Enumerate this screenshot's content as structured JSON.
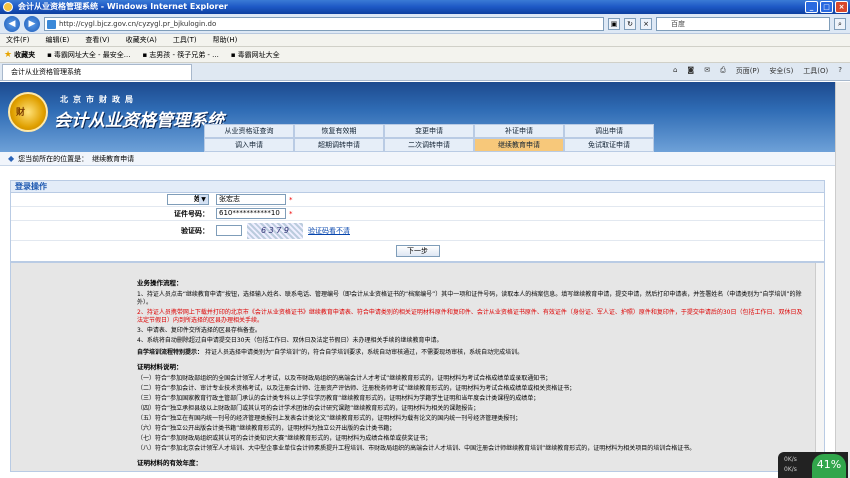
{
  "window": {
    "title": "会计从业资格管理系统 - Windows Internet Explorer",
    "url": "http://cygl.bjcz.gov.cn/cyzygl.pr_bjkulogin.do",
    "search_placeholder": "百度"
  },
  "menu": [
    "文件(F)",
    "编辑(E)",
    "查看(V)",
    "收藏夹(A)",
    "工具(T)",
    "帮助(H)"
  ],
  "favorites": [
    {
      "label": "收藏夹"
    },
    {
      "label": "毒霸网址大全 - 最安全..."
    },
    {
      "label": "志男孩 - 筷子兄弟 - ..."
    },
    {
      "label": "毒霸网址大全"
    }
  ],
  "tab": {
    "label": "会计从业资格管理系统"
  },
  "tools": [
    "页面(P)",
    "安全(S)",
    "工具(O)"
  ],
  "banner": {
    "subtitle": "北京市财政局",
    "brand": "会计从业资格管理系统",
    "logo_text": "财"
  },
  "nav": {
    "row1": [
      "从业资格证查询",
      "恢复有效期",
      "变更申请",
      "补证申请",
      "调出申请"
    ],
    "row2": [
      "调入申请",
      "超期调转申请",
      "二次调转申请",
      "继续教育申请",
      "免试取证申请"
    ],
    "active": "继续教育申请"
  },
  "location": {
    "label": "您当前所在的位置是：",
    "value": "继续教育申请"
  },
  "login": {
    "header": "登录操作",
    "name_select": "姓名",
    "name_value": "张宏志",
    "cert_label": "证件号码：",
    "cert_value": "610***********10",
    "captcha_label": "验证码：",
    "captcha_img_text": "6 3 7 9",
    "captcha_link": "验证码看不清",
    "submit": "下一步"
  },
  "info": {
    "flow_title": "业务操作流程：",
    "steps": [
      "1、持证人员点击“继续教育申请”按钮，选择输入姓名、联系电话、管理编号（即会计从业资格证书的“档案编号”）其中一项和证件号码，读取本人的档案信息。填写继续教育申请，提交申请，然后打印申请表，并签署姓名（申请类别为“自学培训”的除外）。",
      "2、持证人员携带网上下载并打印的北京市《会计从业资格证书》继续教育申请表、符合申请类别的相关证明材料原件和复印件、会计从业资格证书原件、有效证件（身份证、军人证、护照）原件和复印件，于提交申请后的30日（包括工作日、双休日及法定节假日）内到所选择的区县办理相关手续。",
      "3、申请表、复印件交所选择的区县存档备查。",
      "4、系统将自动删除超过自申请提交日30天（包括工作日、双休日及法定节假日）未办理相关手续的继续教育申请。"
    ],
    "self_title": "自学培训流程特别提示：",
    "self_text": "持证人员选择申请类别为“自学培训”的，符合自学培训要求，系统自动审核通过，不需要现场审核，系统自动完成培训。",
    "cert_title": "证明材料说明：",
    "items": [
      "（一）符合“参加财政部组织的全国会计领军人才考试，以及市财政局组织的高端会计人才考试”继续教育形式的，证明材料为考试合格成绩单或录取通知书；",
      "（二）符合“参加会计、审计专业技术资格考试，以及注册会计师、注册资产评估师、注册税务师考试”继续教育形式的，证明材料为考试合格成绩单或相关资格证书；",
      "（三）符合“参加国家教育行政主管部门承认的会计类专科以上学位学历教育”继续教育形式的，证明材料为学籍学生证明和当年度会计类课程的成绩单；",
      "（四）符合“独立承担县级以上财政部门或其认可的会计学术团体的会计研究课题”继续教育形式的，证明材料为相关的课题报告；",
      "（五）符合“独立在有国内统一刊号的经济管理类报刊上发表会计类论文”继续教育形式的，证明材料为载有论文的国内统一刊号经济管理类报刊；",
      "（六）符合“独立公开出版会计类书籍”继续教育形式的，证明材料为独立公开出版的会计类书籍；",
      "（七）符合“参加财政局组织或其认可的会计类知识大赛”继续教育形式的，证明材料为成绩合格单或获奖证书；",
      "（八）符合“参加北京会计领军人才培训、大中型企事业单位会计师素质提升工程培训、市财政局组织的高端会计人才培训、中国注册会计师继续教育培训”继续教育形式的，证明材料为相关项目的培训合格证书。"
    ],
    "validity_title": "证明材料的有效年度："
  },
  "tray": {
    "percent": "41%",
    "up": "0K/s",
    "down": "0K/s"
  }
}
